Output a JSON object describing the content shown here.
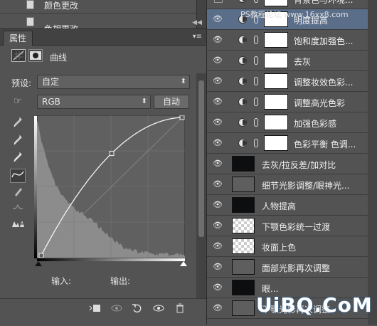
{
  "history": {
    "items": [
      {
        "label": "颜色更改"
      },
      {
        "label": "色相更改"
      }
    ]
  },
  "properties": {
    "tab_label": "属性",
    "collapse_glyph": "◀◀",
    "menu_glyph": "▾≡",
    "panel_title": "曲线",
    "preset_label": "预设:",
    "preset_value": "自定",
    "channel_value": "RGB",
    "auto_button": "自动",
    "input_label": "输入:",
    "output_label": "输出:",
    "curve_points": [
      [
        0,
        0
      ],
      [
        0.5,
        0.74
      ],
      [
        1,
        1
      ]
    ]
  },
  "layers": {
    "items": [
      {
        "name": "背景色与环境...",
        "kind": "adjust",
        "visible": false,
        "selected": false
      },
      {
        "name": "明度提高",
        "kind": "adjust",
        "visible": true,
        "selected": true
      },
      {
        "name": "饱和度加强色...",
        "kind": "adjust",
        "visible": true,
        "selected": false
      },
      {
        "name": "去灰",
        "kind": "adjust",
        "visible": true,
        "selected": false
      },
      {
        "name": "调整妆效色彩...",
        "kind": "adjust",
        "visible": true,
        "selected": false
      },
      {
        "name": "调整高光色彩",
        "kind": "adjust",
        "visible": true,
        "selected": false
      },
      {
        "name": "加强色彩感",
        "kind": "adjust",
        "visible": true,
        "selected": false
      },
      {
        "name": "色彩平衡 色调...",
        "kind": "adjust",
        "visible": true,
        "selected": false
      },
      {
        "name": "去灰/拉反差/加对比",
        "kind": "dark",
        "visible": true,
        "selected": false
      },
      {
        "name": "细节光影调整/眼神光...",
        "kind": "grey",
        "visible": true,
        "selected": false
      },
      {
        "name": "人物提高",
        "kind": "dark",
        "visible": true,
        "selected": false
      },
      {
        "name": "下颚色彩统一过渡",
        "kind": "check",
        "visible": true,
        "selected": false
      },
      {
        "name": "妆面上色",
        "kind": "check",
        "visible": true,
        "selected": false
      },
      {
        "name": "面部光影再次调整",
        "kind": "grey",
        "visible": true,
        "selected": false
      },
      {
        "name": "眼...",
        "kind": "dark",
        "visible": true,
        "selected": false
      },
      {
        "name": "下颚光影再次调整",
        "kind": "grey",
        "visible": true,
        "selected": false
      }
    ]
  },
  "watermark": "PS教程论坛 www.16xx8.com",
  "logo": "UiBQ.CoM",
  "colors": {
    "selected_row": "#5a6e8a",
    "panel": "#535353",
    "accent_logo_glow": "#2a6fb0"
  }
}
